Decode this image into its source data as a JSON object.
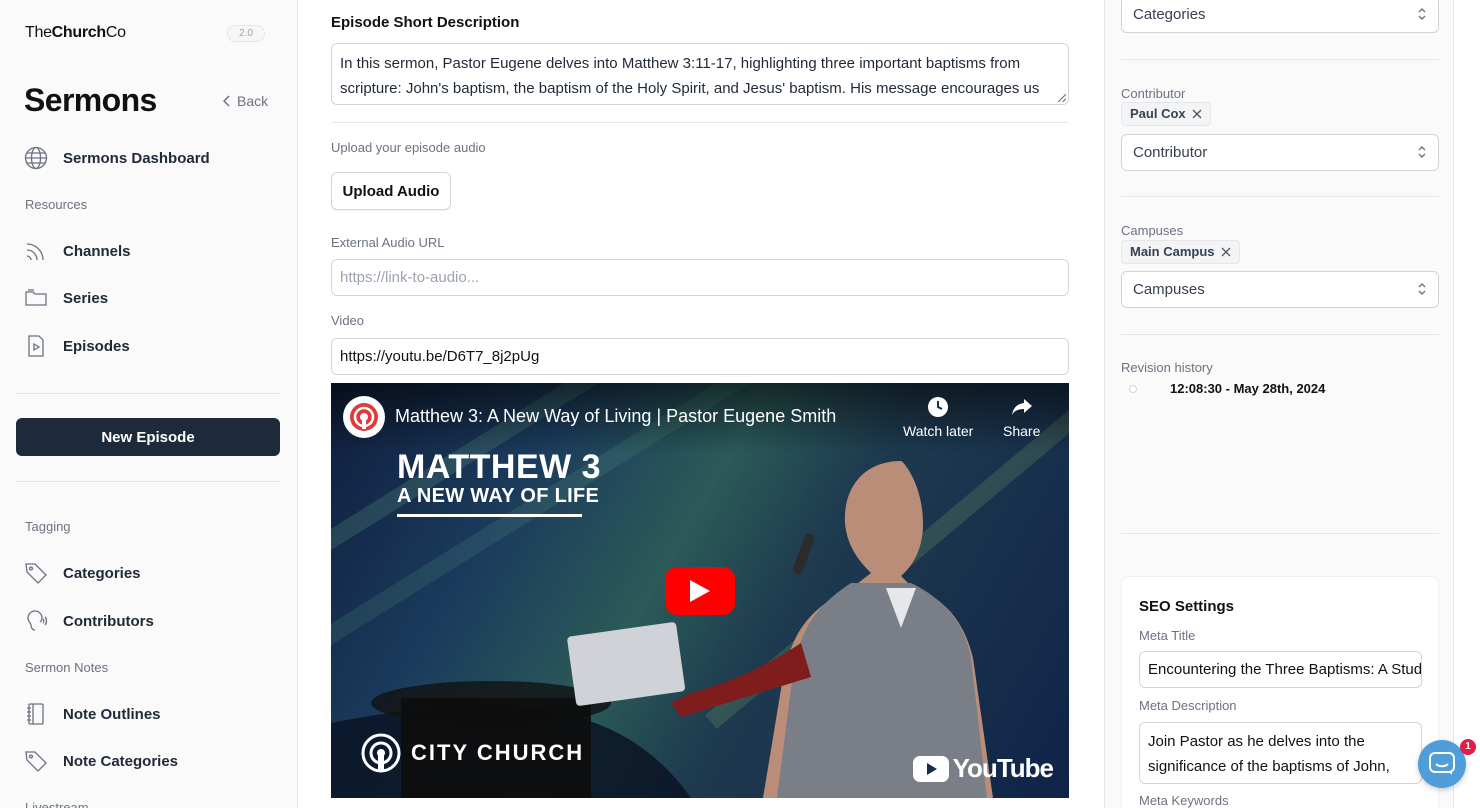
{
  "sidebar": {
    "brand_light": "The",
    "brand_bold": "Church",
    "brand_end": "Co",
    "version": "2.0",
    "page_title": "Sermons",
    "back_label": "Back",
    "dashboard_label": "Sermons Dashboard",
    "resources_label": "Resources",
    "resources": [
      {
        "label": "Channels",
        "icon": "rss-icon"
      },
      {
        "label": "Series",
        "icon": "folder-icon"
      },
      {
        "label": "Episodes",
        "icon": "play-file-icon"
      }
    ],
    "new_episode_label": "New Episode",
    "tagging_label": "Tagging",
    "tagging": [
      {
        "label": "Categories",
        "icon": "tag-icon"
      },
      {
        "label": "Contributors",
        "icon": "speaker-icon"
      }
    ],
    "notes_label": "Sermon Notes",
    "notes": [
      {
        "label": "Note Outlines",
        "icon": "notebook-icon"
      },
      {
        "label": "Note Categories",
        "icon": "tag-icon"
      }
    ],
    "livestream_label": "Livestream"
  },
  "main": {
    "short_desc_title": "Episode Short Description",
    "short_desc_value": "In this sermon, Pastor Eugene delves into Matthew 3:11-17, highlighting three important baptisms from scripture: John's baptism, the baptism of the Holy Spirit, and Jesus' baptism. His message encourages us",
    "upload_audio_label": "Upload your episode audio",
    "upload_audio_button": "Upload Audio",
    "external_audio_label": "External Audio URL",
    "external_audio_placeholder": "https://link-to-audio...",
    "video_label": "Video",
    "video_value": "https://youtu.be/D6T7_8j2pUg"
  },
  "video": {
    "title": "Matthew 3: A New Way of Living | Pastor Eugene Smith",
    "watch_later": "Watch later",
    "share": "Share",
    "graphic_line1": "MATTHEW 3",
    "graphic_line2": "A NEW WAY OF LIFE",
    "church_name": "CITY CHURCH",
    "platform": "YouTube"
  },
  "right": {
    "categories_placeholder": "Categories",
    "contributor_label": "Contributor",
    "contributor_tag": "Paul Cox",
    "contributor_placeholder": "Contributor",
    "campuses_label": "Campuses",
    "campus_tag": "Main Campus",
    "campuses_placeholder": "Campuses",
    "revision_label": "Revision history",
    "revision_item": "12:08:30 - May 28th, 2024",
    "seo": {
      "title": "SEO Settings",
      "meta_title_label": "Meta Title",
      "meta_title_value": "Encountering the Three Baptisms: A Study",
      "meta_desc_label": "Meta Description",
      "meta_desc_value": "Join Pastor as he delves into the significance of the baptisms of John,",
      "meta_keywords_label": "Meta Keywords"
    }
  },
  "chat": {
    "badge": "1"
  },
  "colors": {
    "primary_button": "#1e293b",
    "play_red": "#ff0000",
    "chat_blue": "#4f9ed9",
    "badge_red": "#e11d48"
  }
}
